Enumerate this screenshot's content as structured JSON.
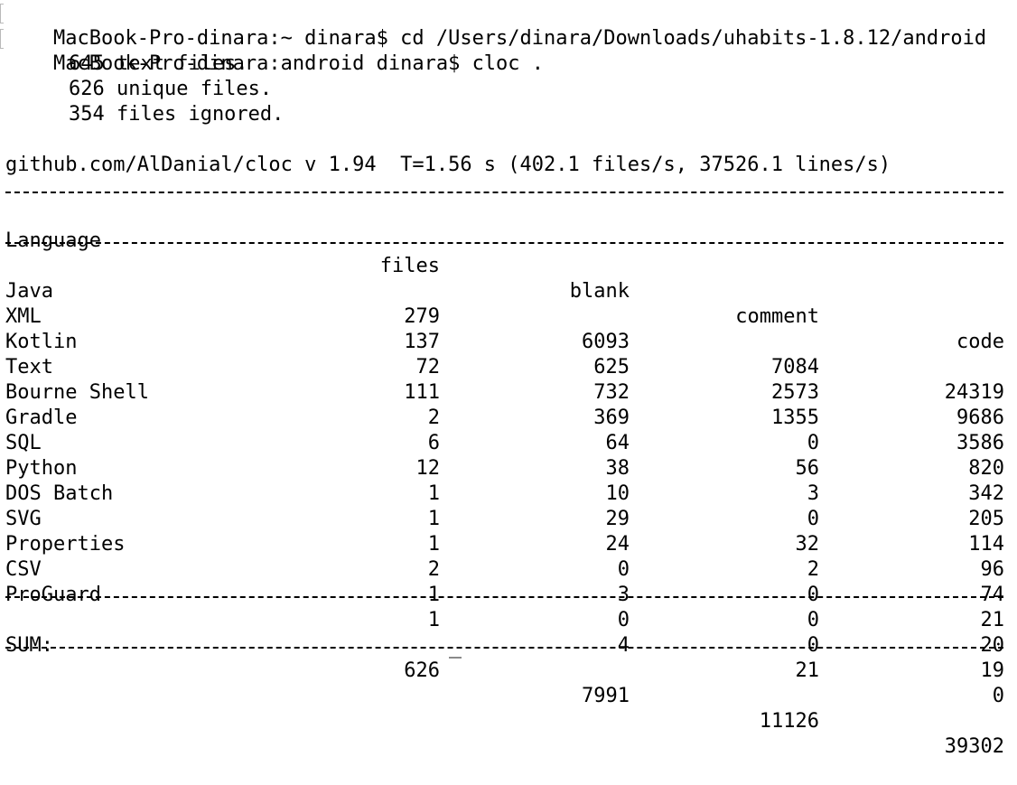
{
  "terminal": {
    "command_lines": [
      "MacBook-Pro-dinara:~ dinara$ cd /Users/dinara/Downloads/uhabits-1.8.12/android",
      "MacBook-Pro-dinara:android dinara$ cloc ."
    ],
    "summary": [
      "645 text files.",
      "626 unique files.",
      "354 files ignored."
    ],
    "header_line": "github.com/AlDanial/cloc v 1.94  T=1.56 s (402.1 files/s, 37526.1 lines/s)"
  },
  "table": {
    "columns": [
      "Language",
      "files",
      "blank",
      "comment",
      "code"
    ],
    "rows": [
      [
        "Java",
        "279",
        "6093",
        "7084",
        "24319"
      ],
      [
        "XML",
        "137",
        "625",
        "2573",
        "9686"
      ],
      [
        "Kotlin",
        "72",
        "732",
        "1355",
        "3586"
      ],
      [
        "Text",
        "111",
        "369",
        "0",
        "820"
      ],
      [
        "Bourne Shell",
        "2",
        "64",
        "56",
        "342"
      ],
      [
        "Gradle",
        "6",
        "38",
        "3",
        "205"
      ],
      [
        "SQL",
        "12",
        "10",
        "0",
        "114"
      ],
      [
        "Python",
        "1",
        "29",
        "32",
        "96"
      ],
      [
        "DOS Batch",
        "1",
        "24",
        "2",
        "74"
      ],
      [
        "SVG",
        "1",
        "0",
        "0",
        "21"
      ],
      [
        "Properties",
        "2",
        "3",
        "0",
        "20"
      ],
      [
        "CSV",
        "1",
        "0",
        "0",
        "19"
      ],
      [
        "ProGuard",
        "1",
        "4",
        "21",
        "0"
      ]
    ],
    "sum": [
      "SUM:",
      "626",
      "7991",
      "11126",
      "39302"
    ]
  }
}
